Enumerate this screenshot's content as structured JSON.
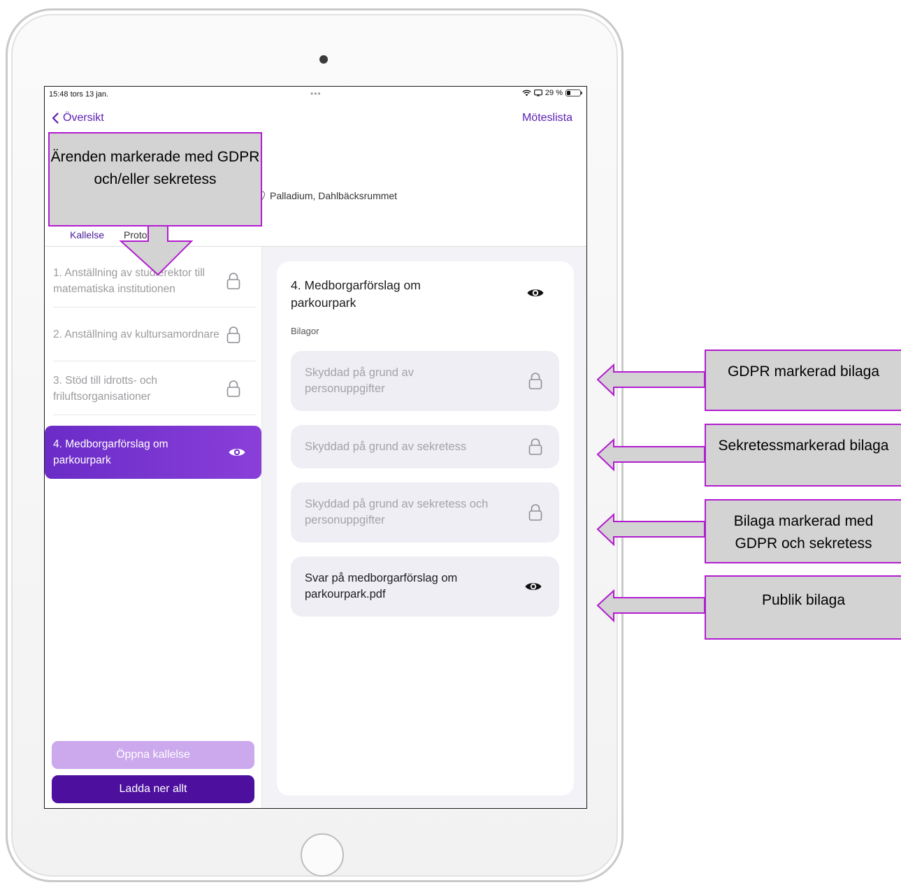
{
  "status_bar": {
    "time": "15:48  tors 13 jan.",
    "dots": "•••",
    "battery": "29 %",
    "battery_level": 0.29
  },
  "nav": {
    "back_label": "Översikt",
    "meeting_list_label": "Möteslista"
  },
  "meeting": {
    "location": "Palladium, Dahlbäcksrummet"
  },
  "tabs": [
    {
      "label": "Kallelse",
      "active": true
    },
    {
      "label": "Protokoll",
      "active": false
    }
  ],
  "agenda_items": [
    {
      "title": "1. Anställning av studierektor till matematiska institutionen",
      "icon": "lock-icon"
    },
    {
      "title": "2. Anställning av kultursamordnare",
      "icon": "lock-icon"
    },
    {
      "title": "3. Stöd till idrotts- och friluftsorganisationer",
      "icon": "lock-icon"
    },
    {
      "title": "4. Medborgarförslag om parkourpark",
      "icon": "eye-icon",
      "selected": true
    }
  ],
  "buttons": {
    "open": "Öppna kallelse",
    "download": "Ladda ner allt"
  },
  "detail": {
    "title": "4. Medborgarförslag om parkourpark",
    "attachments_label": "Bilagor",
    "attachments": [
      {
        "text": "Skyddad på grund av personuppgifter",
        "icon": "lock-icon"
      },
      {
        "text": "Skyddad på grund av sekretess",
        "icon": "lock-icon"
      },
      {
        "text": "Skyddad på grund av sekretess och personuppgifter",
        "icon": "lock-icon"
      },
      {
        "text": "Svar på medborgarförslag om parkourpark.pdf",
        "icon": "eye-icon"
      }
    ]
  },
  "callouts": {
    "top": "Ärenden markerade med GDPR och/eller sekretess",
    "gdpr": "GDPR markerad bilaga",
    "secrecy": "Sekretessmarkerad bilaga",
    "both": "Bilaga markerad med GDPR och sekretess",
    "public": "Publik bilaga"
  },
  "colors": {
    "accent": "#5b1fb3",
    "callout_border": "#b21ccf",
    "callout_fill": "#d3d3d3"
  }
}
